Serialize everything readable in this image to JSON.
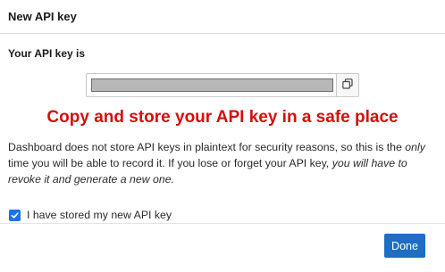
{
  "dialog": {
    "title": "New API key",
    "key_label": "Your API key is",
    "api_key_value": "",
    "copy_icon": "copy-icon",
    "warning": "Copy and store your API key in a safe place",
    "message": {
      "part1": "Dashboard does not store API keys in plaintext for security reasons, so this is the ",
      "em1": "only",
      "part2": " time you will be able to record it. If you lose or forget your API key, ",
      "em2": "you will have to revoke it and generate a new one."
    },
    "confirm_label": "I have stored my new API key",
    "confirm_checked": true,
    "done_label": "Done"
  },
  "colors": {
    "warning": "#d40e0e",
    "primary": "#1c6fc2",
    "checkbox": "#1a73e8"
  }
}
